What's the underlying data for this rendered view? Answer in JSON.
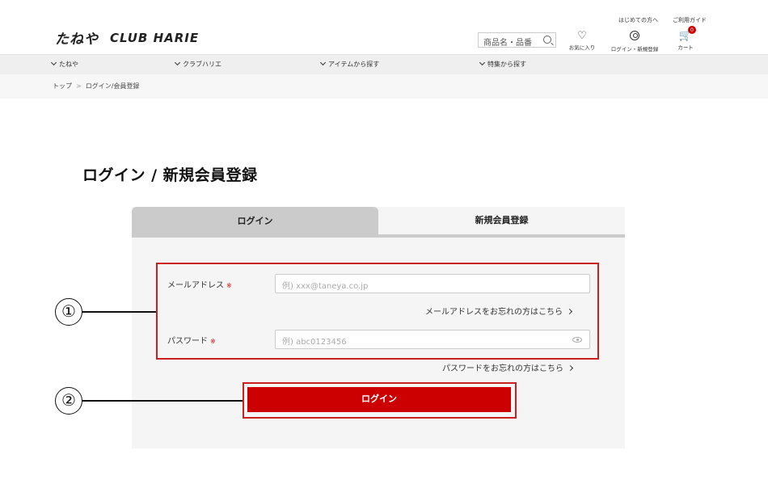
{
  "header": {
    "logo_tane": "たねや",
    "logo_club": "CLUB HARIE",
    "top_links": [
      "はじめての方へ",
      "ご利用ガイド"
    ],
    "search_placeholder": "商品名・品番",
    "icons": {
      "favorites_label": "お気に入り",
      "account_label": "ログイン・新規登録",
      "cart_label": "カート",
      "cart_count": "0"
    }
  },
  "nav": {
    "items": [
      "たねや",
      "クラブハリエ",
      "アイテムから探す",
      "特集から探す"
    ]
  },
  "breadcrumb": {
    "home": "トップ",
    "current": "ログイン/会員登録"
  },
  "page_title": "ログイン / 新規会員登録",
  "tabs": {
    "login": "ログイン",
    "register": "新規会員登録"
  },
  "form": {
    "email_label": "メールアドレス",
    "email_placeholder": "例) xxx@taneya.co.jp",
    "forgot_email": "メールアドレスをお忘れの方はこちら",
    "password_label": "パスワード",
    "password_placeholder": "例) abc0123456",
    "forgot_password": "パスワードをお忘れの方はこちら",
    "required_mark": "※",
    "login_button": "ログイン"
  },
  "annotations": [
    "①",
    "②"
  ],
  "colors": {
    "accent": "#cc0000",
    "annotation": "#cc1f1f",
    "tab_active": "#cbcbcb",
    "panel": "#f5f5f5"
  }
}
